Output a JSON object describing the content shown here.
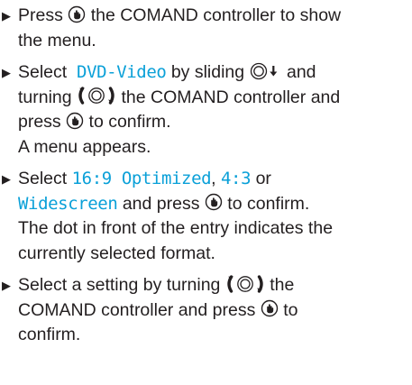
{
  "colors": {
    "text": "#231f20",
    "menu_term": "#0aa0d8"
  },
  "steps": [
    {
      "lines": [
        [
          "Press",
          "the COMAND controller to show"
        ],
        [
          "the menu."
        ]
      ]
    },
    {
      "select_word": "Select",
      "menu_term": "DVD-Video",
      "text_by_sliding": "by sliding",
      "text_and": "and",
      "text_turning": "turning",
      "text_controller_and": "the COMAND controller and",
      "text_press": "press",
      "text_to_confirm": "to confirm.",
      "result": "A menu appears."
    },
    {
      "select_word": "Select",
      "term_1": "16:9 Optimized",
      "comma": ",",
      "term_2": "4:3",
      "text_or": "or",
      "term_3": "Widescreen",
      "text_and_press": "and press",
      "text_to_confirm": "to confirm.",
      "line_3": "The dot in front of the entry indicates the",
      "line_4": "currently selected format."
    },
    {
      "text_select_setting": "Select a setting by turning",
      "text_the": "the",
      "line_2_a": "COMAND controller and press",
      "line_2_b": "to",
      "line_3": "confirm."
    }
  ],
  "icons": {
    "press": "press-controller-icon",
    "slide": "slide-controller-down-icon",
    "turn": "turn-controller-icon"
  }
}
